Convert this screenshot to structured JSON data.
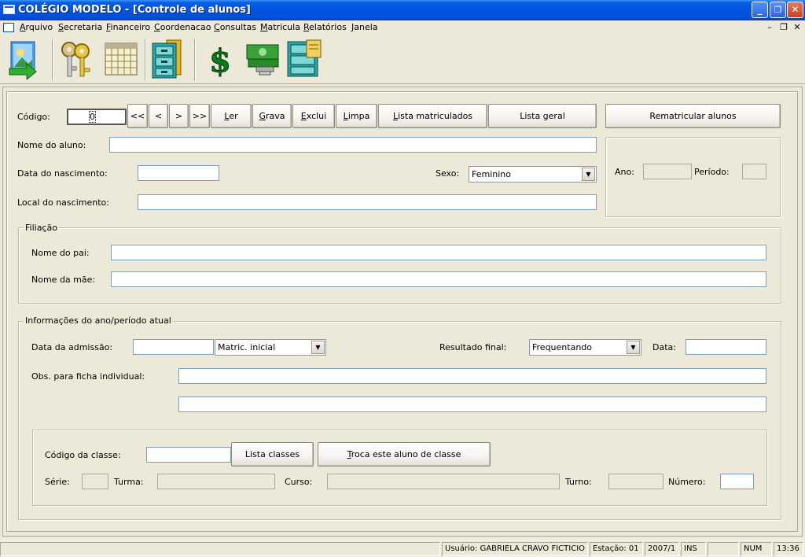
{
  "window": {
    "title": "COLÉGIO MODELO - [Controle de alunos]",
    "min_label": "_",
    "max_label": "❐",
    "close_label": "✕"
  },
  "menu": {
    "items": [
      "Arquivo",
      "Secretaria",
      "Financeiro",
      "Coordenacao",
      "Consultas",
      "Matricula",
      "Relatórios",
      "Janela"
    ],
    "mdi_min": "–",
    "mdi_restore": "❐",
    "mdi_close": "✕"
  },
  "toolbar": {
    "buttons": [
      "exit-door-icon",
      "keys-icon",
      "calendar-icon",
      "filing-cabinet-icon",
      "dollar-icon",
      "money-cash-icon",
      "file-cabinet-open-icon"
    ]
  },
  "form": {
    "codigo_label": "Código:",
    "codigo_value": "0",
    "nav_first": "<<",
    "nav_prev": "<",
    "nav_next": ">",
    "nav_last": ">>",
    "ler": "Ler",
    "grava": "Grava",
    "exclui": "Exclui",
    "limpa": "Limpa",
    "lista_matriculados": "Lista matriculados",
    "lista_geral": "Lista geral",
    "rematricular": "Rematricular alunos",
    "nome_aluno_label": "Nome do aluno:",
    "nome_aluno_value": "",
    "data_nasc_label": "Data do nascimento:",
    "data_nasc_value": "",
    "sexo_label": "Sexo:",
    "sexo_value": "Feminino",
    "local_nasc_label": "Local do nascimento:",
    "local_nasc_value": "",
    "ano_label": "Ano:",
    "ano_value": "",
    "periodo_label": "Período:",
    "periodo_value": ""
  },
  "filiacao": {
    "title": "Filiação",
    "pai_label": "Nome do pai:",
    "pai_value": "",
    "mae_label": "Nome da mãe:",
    "mae_value": ""
  },
  "info": {
    "title": "Informações do ano/período atual",
    "admissao_label": "Data da admissão:",
    "admissao_value": "",
    "tipo_matricula": "Matric. inicial",
    "resultado_label": "Resultado final:",
    "resultado_value": "Frequentando",
    "data_label": "Data:",
    "data_value": "",
    "obs_label": "Obs. para ficha individual:",
    "obs_line1": "",
    "obs_line2": ""
  },
  "classe": {
    "codigo_label": "Código da classe:",
    "codigo_value": "",
    "lista_classes": "Lista classes",
    "troca": "Troca este aluno de classe",
    "serie_label": "Série:",
    "turma_label": "Turma:",
    "curso_label": "Curso:",
    "turno_label": "Turno:",
    "numero_label": "Número:"
  },
  "status": {
    "usuario": "Usuário: GABRIELA CRAVO FICTICIO",
    "estacao": "Estação: 01",
    "periodo": "2007/1",
    "ins": "INS",
    "num": "NUM",
    "time": "13:36"
  }
}
